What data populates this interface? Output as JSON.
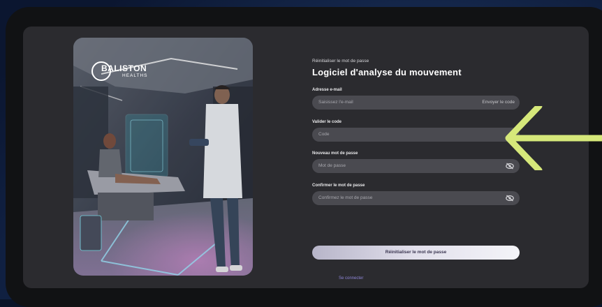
{
  "brand": {
    "name": "BALISTON",
    "sub": "HEALTHS"
  },
  "form": {
    "subtitle": "Réinitialiser le mot de passe",
    "title": "Logiciel d'analyse du mouvement",
    "email": {
      "label": "Adresse e-mail",
      "placeholder": "Saisissez l'e-mail",
      "send_code": "Envoyer le code"
    },
    "code": {
      "label": "Valider le code",
      "placeholder": "Code"
    },
    "new_password": {
      "label": "Nouveau mot de passe",
      "placeholder": "Mot de passe"
    },
    "confirm_password": {
      "label": "Confirmer le mot de passe",
      "placeholder": "Confirmez le mot de passe"
    },
    "submit_label": "Réinitialiser le mot de passe",
    "login_link": "Se connecter"
  },
  "colors": {
    "panel": "#2b2b2f",
    "field": "#4a4a50",
    "link": "#8f86d8",
    "arrow": "#d6e87a"
  },
  "icons": [
    "eye-off-icon",
    "logo-ring-icon",
    "arrow-left-icon"
  ]
}
